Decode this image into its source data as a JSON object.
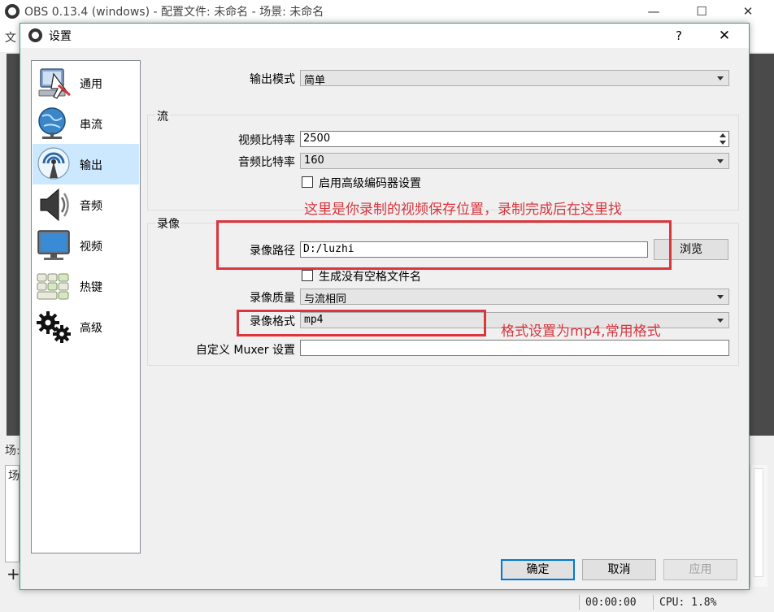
{
  "main_window": {
    "title": "OBS 0.13.4 (windows) - 配置文件: 未命名 - 场景: 未命名",
    "menu_first": "文",
    "scenes_label": "场:",
    "scenes_header": "场",
    "add_symbol": "+",
    "min_symbol": "—",
    "max_symbol": "☐",
    "close_symbol": "✕",
    "status": {
      "time": "00:00:00",
      "cpu": "CPU: 1.8%"
    }
  },
  "dialog": {
    "title": "设置",
    "help_symbol": "?",
    "close_symbol": "✕",
    "sidebar": [
      {
        "label": "通用",
        "icon": "computer-cursor-icon"
      },
      {
        "label": "串流",
        "icon": "globe-network-icon"
      },
      {
        "label": "输出",
        "icon": "broadcast-antenna-icon",
        "selected": true
      },
      {
        "label": "音频",
        "icon": "speaker-icon"
      },
      {
        "label": "视频",
        "icon": "monitor-icon"
      },
      {
        "label": "热键",
        "icon": "keyboard-icon"
      },
      {
        "label": "高级",
        "icon": "gears-icon"
      }
    ],
    "output_mode": {
      "label": "输出模式",
      "value": "简单"
    },
    "streaming": {
      "title": "流",
      "video_bitrate": {
        "label": "视频比特率",
        "value": "2500"
      },
      "audio_bitrate": {
        "label": "音频比特率",
        "value": "160"
      },
      "advanced_encoder": {
        "label": "启用高级编码器设置",
        "checked": false
      }
    },
    "recording": {
      "title": "录像",
      "path": {
        "label": "录像路径",
        "value": "D:/luzhi",
        "browse": "浏览"
      },
      "no_space_filename": {
        "label": "生成没有空格文件名",
        "checked": false
      },
      "quality": {
        "label": "录像质量",
        "value": "与流相同"
      },
      "format": {
        "label": "录像格式",
        "value": "mp4"
      },
      "custom_muxer": {
        "label": "自定义 Muxer 设置",
        "value": ""
      }
    },
    "buttons": {
      "ok": "确定",
      "cancel": "取消",
      "apply": "应用"
    }
  },
  "annotations": {
    "path_note": "这里是你录制的视频保存位置，录制完成后在这里找",
    "format_note": "格式设置为mp4,常用格式"
  },
  "colors": {
    "annotation_red": "#d9363e",
    "selection": "#cce8ff",
    "dialog_border": "#3aa089"
  }
}
